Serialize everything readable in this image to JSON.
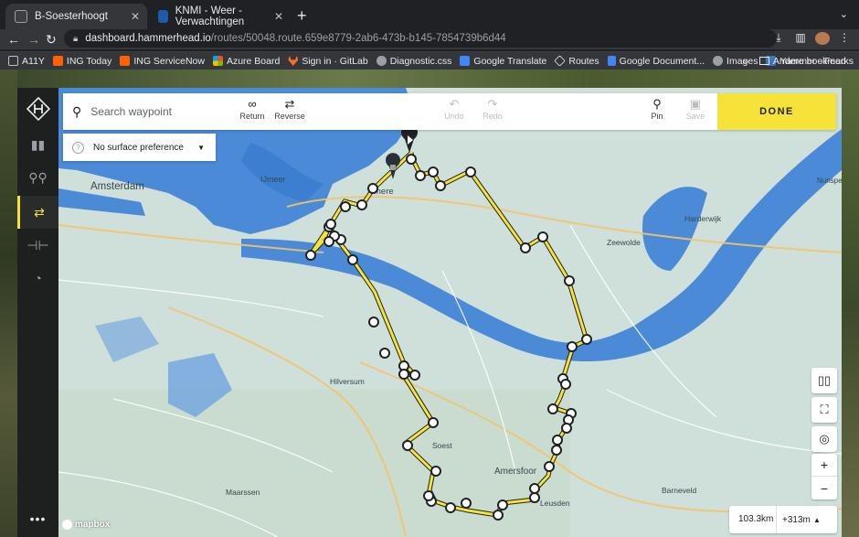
{
  "browser": {
    "tabs": [
      {
        "title": "B-Soesterhoogt",
        "active": true
      },
      {
        "title": "KNMI - Weer - Verwachtingen",
        "active": false
      }
    ],
    "url_host": "dashboard.hammerhead.io",
    "url_path": "/routes/50048.route.659e8779-2ab6-473b-b145-7854739b6d44",
    "bookmarks": [
      {
        "label": "A11Y",
        "color": "#5f6368"
      },
      {
        "label": "ING Today",
        "color": "#ff6200"
      },
      {
        "label": "ING ServiceNow",
        "color": "#ff6200"
      },
      {
        "label": "Azure Board",
        "color": "#e8453c"
      },
      {
        "label": "Sign in · GitLab",
        "color": "#fc6d26"
      },
      {
        "label": "Diagnostic.css",
        "color": "#9aa0a6"
      },
      {
        "label": "Google Translate",
        "color": "#4285f4"
      },
      {
        "label": "Routes",
        "color": "#202124"
      },
      {
        "label": "Google Document...",
        "color": "#4285f4"
      },
      {
        "label": "Images",
        "color": "#9aa0a6"
      },
      {
        "label": "Yammer - Feed",
        "color": "#3a76c4"
      }
    ],
    "bookmarks_overflow": "»",
    "other_bookmarks": "Andere bookmarks"
  },
  "app": {
    "search_placeholder": "Search waypoint",
    "tools": {
      "return": "Return",
      "reverse": "Reverse",
      "undo": "Undo",
      "redo": "Redo",
      "pin": "Pin",
      "save": "Save"
    },
    "done_label": "DONE",
    "surface_preference": "No surface preference",
    "distance": "103.3km",
    "elevation": "+313m",
    "attribution": "mapbox"
  },
  "map_labels": {
    "amsterdam": "Amsterdam",
    "ijmeer": "IJmeer",
    "almere": "mere",
    "harderwijk": "Harderwijk",
    "zeewolde": "Zeewolde",
    "nunspeet": "Nunspee",
    "hilversum": "Hilversum",
    "soest": "Soest",
    "amersfoort": "Amersfoor",
    "leusden": "Leusden",
    "barneveld": "Barneveld",
    "maarssen": "Maarssen"
  },
  "colors": {
    "route": "#f6e33a",
    "accent": "#f6e33a",
    "water": "#4a8ad6",
    "land": "#cfe0da"
  }
}
